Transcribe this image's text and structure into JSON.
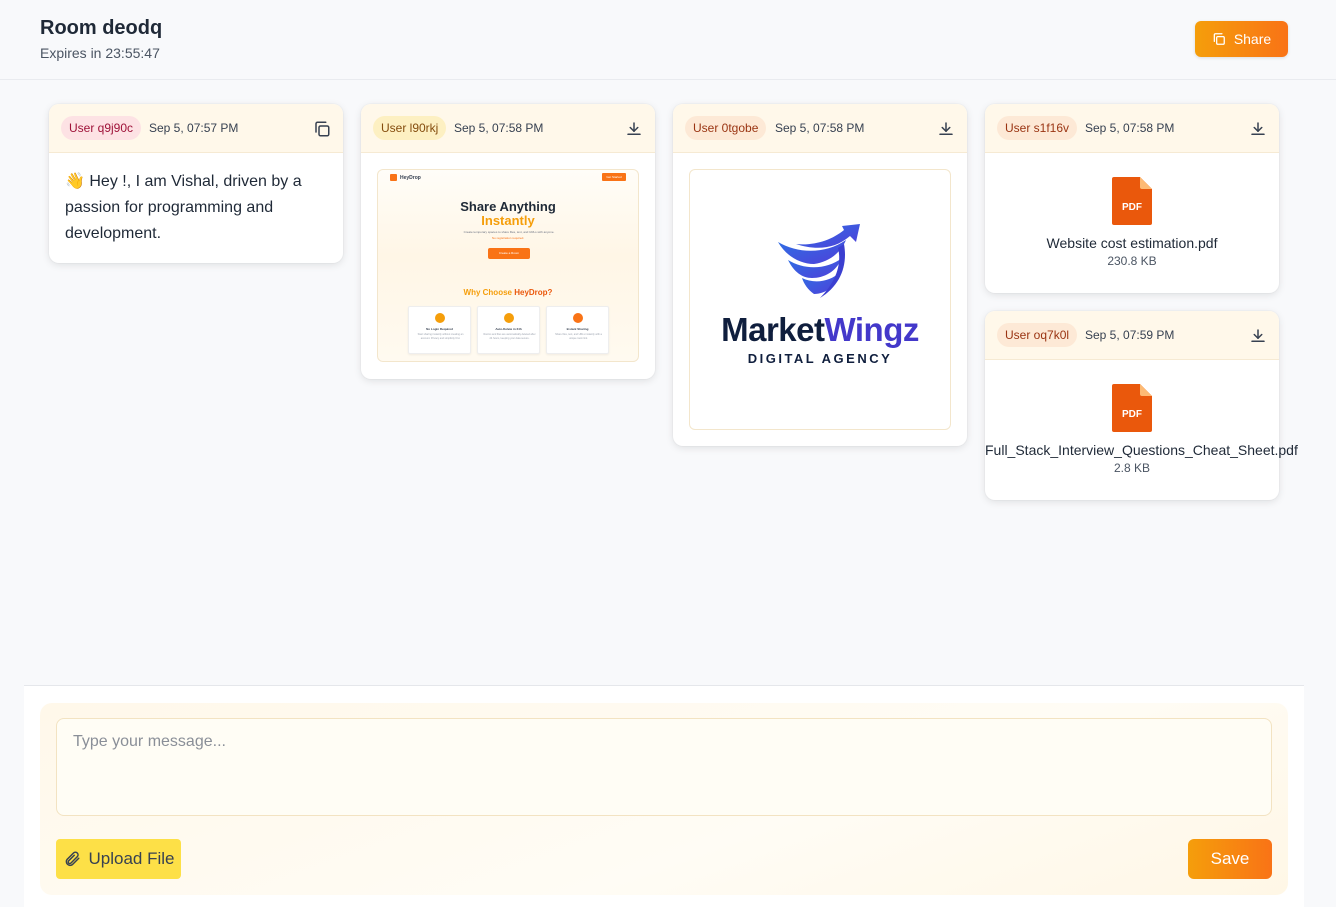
{
  "header": {
    "title": "Room deodq",
    "expires": "Expires in 23:55:47",
    "share_label": "Share"
  },
  "cards": {
    "c1": {
      "user": "User q9j90c",
      "time": "Sep 5, 07:57 PM",
      "text": "👋 Hey !, I am Vishal, driven by a passion for programming and development.",
      "badge_bg": "#fde2e4",
      "badge_fg": "#9f1239",
      "action_icon": "copy-icon"
    },
    "c2": {
      "user": "User l90rkj",
      "time": "Sep 5, 07:58 PM",
      "badge_bg": "#fdf0c2",
      "badge_fg": "#854d0e",
      "action_icon": "download-icon",
      "preview": {
        "brand": "HeyDrop",
        "nav_button": "Get Started",
        "headline": "Share Anything",
        "headline_accent": "Instantly",
        "subline": "Create temporary spaces to share files, text, and URLs with anyone.",
        "subline_accent": "No registration required.",
        "cta": "Create a Room",
        "section_title": "Why Choose",
        "section_accent": "HeyDrop?",
        "features": [
          {
            "title": "No Login Required",
            "desc": "Start sharing instantly without creating an account. Privacy and simplicity first."
          },
          {
            "title": "Auto-Delete in 24h",
            "desc": "Rooms and files are automatically deleted after 24 hours, keeping your data secure."
          },
          {
            "title": "Instant Sharing",
            "desc": "Share files, text, and URLs instantly with a unique room link."
          }
        ]
      }
    },
    "c3": {
      "user": "User 0tgobe",
      "time": "Sep 5, 07:58 PM",
      "badge_bg": "#fde9d6",
      "badge_fg": "#9a3412",
      "action_icon": "download-icon",
      "logo": {
        "word1": "Market",
        "word2": "Wingz",
        "tagline": "DIGITAL AGENCY"
      }
    },
    "c4": {
      "user": "User s1f16v",
      "time": "Sep 5, 07:58 PM",
      "badge_bg": "#fde9d6",
      "badge_fg": "#9a3412",
      "action_icon": "download-icon",
      "file_type": "PDF",
      "file_name": "Website cost estimation.pdf",
      "file_size": "230.8 KB"
    },
    "c5": {
      "user": "User oq7k0l",
      "time": "Sep 5, 07:59 PM",
      "badge_bg": "#fde9d6",
      "badge_fg": "#9a3412",
      "action_icon": "download-icon",
      "file_type": "PDF",
      "file_name": "Full_Stack_Interview_Questions_Cheat_Sheet.pdf",
      "file_size": "2.8 KB"
    }
  },
  "composer": {
    "placeholder": "Type your message...",
    "upload_label": "Upload File",
    "save_label": "Save"
  },
  "colors": {
    "accent": "#f97316",
    "accent_light": "#f59e0b",
    "upload_bg": "#fde047",
    "pdf": "#ea580c"
  }
}
